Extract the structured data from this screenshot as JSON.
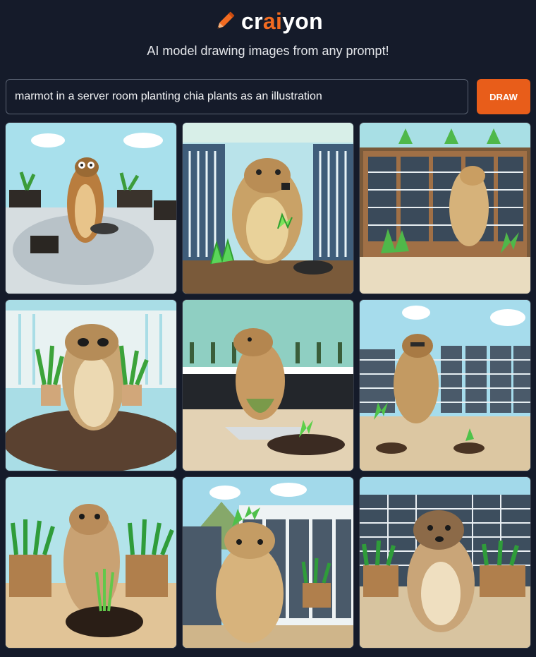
{
  "app": {
    "logo_icon": "pencil-icon",
    "logo_text_part1": "cr",
    "logo_text_part2": "ai",
    "logo_text_part3": "yon",
    "subtitle": "AI model drawing images from any prompt!",
    "accent_color": "#f26b21",
    "background_color": "#151b2a"
  },
  "prompt": {
    "value": "marmot in a server room planting chia plants as an illustration",
    "button_label": "DRAW"
  },
  "results": {
    "image_count": 9,
    "subject": "marmot"
  }
}
